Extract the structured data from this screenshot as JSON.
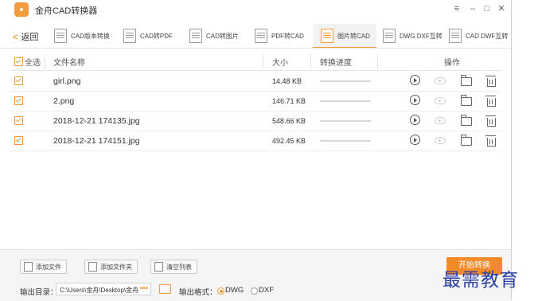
{
  "app": {
    "title": "金舟CAD转换器"
  },
  "window_controls": {
    "menu": "≡",
    "minimize": "–",
    "maximize": "□",
    "close": "✕"
  },
  "nav": {
    "back_label": "返回",
    "tabs": [
      {
        "label": "CAD版本转换",
        "active": false
      },
      {
        "label": "CAD转PDF",
        "active": false
      },
      {
        "label": "CAD转图片",
        "active": false
      },
      {
        "label": "PDF转CAD",
        "active": false
      },
      {
        "label": "图片转CAD",
        "active": true
      },
      {
        "label": "DWG DXF互转",
        "active": false
      },
      {
        "label": "CAD DWF互转",
        "active": false
      }
    ]
  },
  "table": {
    "headers": {
      "select_all": "全选",
      "file_name": "文件名称",
      "size": "大小",
      "progress": "转换进度",
      "actions": "操作"
    },
    "rows": [
      {
        "name": "girl.png",
        "size": "14.48 KB",
        "checked": true,
        "progress": 0
      },
      {
        "name": "2.png",
        "size": "146.71 KB",
        "checked": true,
        "progress": 0
      },
      {
        "name": "2018-12-21 174135.jpg",
        "size": "548.66 KB",
        "checked": true,
        "progress": 0
      },
      {
        "name": "2018-12-21 174151.jpg",
        "size": "492.45 KB",
        "checked": true,
        "progress": 0
      }
    ]
  },
  "bottom": {
    "add_file": "添加文件",
    "add_folder": "添加文件夹",
    "clear_list": "清空列表",
    "output_dir_label": "输出目录：",
    "output_dir_value": "C:\\Users\\金舟\\Desktop\\金舟",
    "browse_dots": "•••",
    "output_format_label": "输出格式：",
    "format_options": [
      "DWG",
      "DXF"
    ],
    "selected_format": "DWG",
    "start_button": "开始转换"
  },
  "watermark": "最需教育",
  "colors": {
    "accent": "#f39a3c",
    "start_button": "#f28a2a",
    "watermark": "#2a3fa5"
  }
}
